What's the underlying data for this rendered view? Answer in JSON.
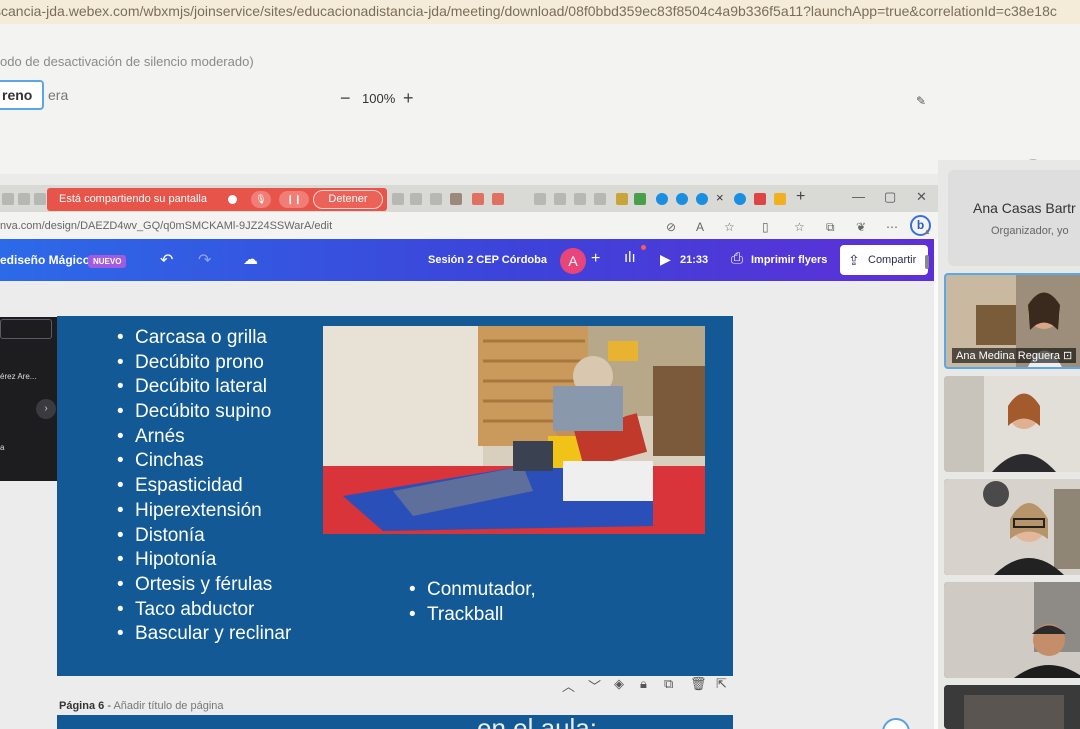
{
  "webex": {
    "url": "scancia-jda.webex.com/wbxmjs/joinservice/sites/educacionadistancia-jda/meeting/download/08f0bbd359ec83f8504c4a9b336f5a11?launchApp=true&correlationId=c38e18c",
    "mute_mode": "odo de desactivación de silencio moderado)",
    "view_button": "reno",
    "view_tail": "era",
    "zoom_level": "100%",
    "zoom_minus": "−",
    "zoom_plus": "+"
  },
  "browser": {
    "sharing": {
      "label": "Está compartiendo su pantalla",
      "stop": "Detener"
    },
    "address": "nva.com/design/DAEZD4wv_GQ/q0mSMCKAMl-9JZ24SSWarA/edit",
    "tab_close": "×",
    "tab_plus": "+",
    "window_buttons": [
      "—",
      "▢",
      "✕"
    ]
  },
  "canva": {
    "magic": "ediseño Mágico",
    "badge": "NUEVO",
    "session": "Sesión 2 CEP Córdoba",
    "avatar": "A",
    "time": "21:33",
    "print": "Imprimir flyers",
    "share": "Compartir",
    "left_panel_text": "érez Are...",
    "left_panel_mini": "a"
  },
  "slide": {
    "bullets": [
      "Carcasa o grilla",
      "Decúbito prono",
      "Decúbito lateral",
      "Decúbito supino",
      "Arnés",
      "Cinchas",
      "Espasticidad",
      "Hiperextensión",
      "Distonía",
      "Hipotonía",
      "Ortesis y férulas",
      "Taco abductor",
      "Bascular y reclinar"
    ],
    "bullets_right": [
      "Conmutador,",
      "Trackball"
    ],
    "page_label": "Página 6",
    "page_hint": "Añadir título de página",
    "next_slide_peek": "en el aula:"
  },
  "participants": {
    "organizer_name": "Ana Casas Bartr",
    "organizer_role": "Organizador, yo",
    "active_speaker": "Ana Medina Reguera"
  },
  "colors": {
    "canva_gradient_start": "#2c6ae8",
    "canva_gradient_end": "#5e2fd8",
    "slide_bg": "#135996",
    "share_red": "#e7544a",
    "active_border": "#5ba8e8"
  }
}
